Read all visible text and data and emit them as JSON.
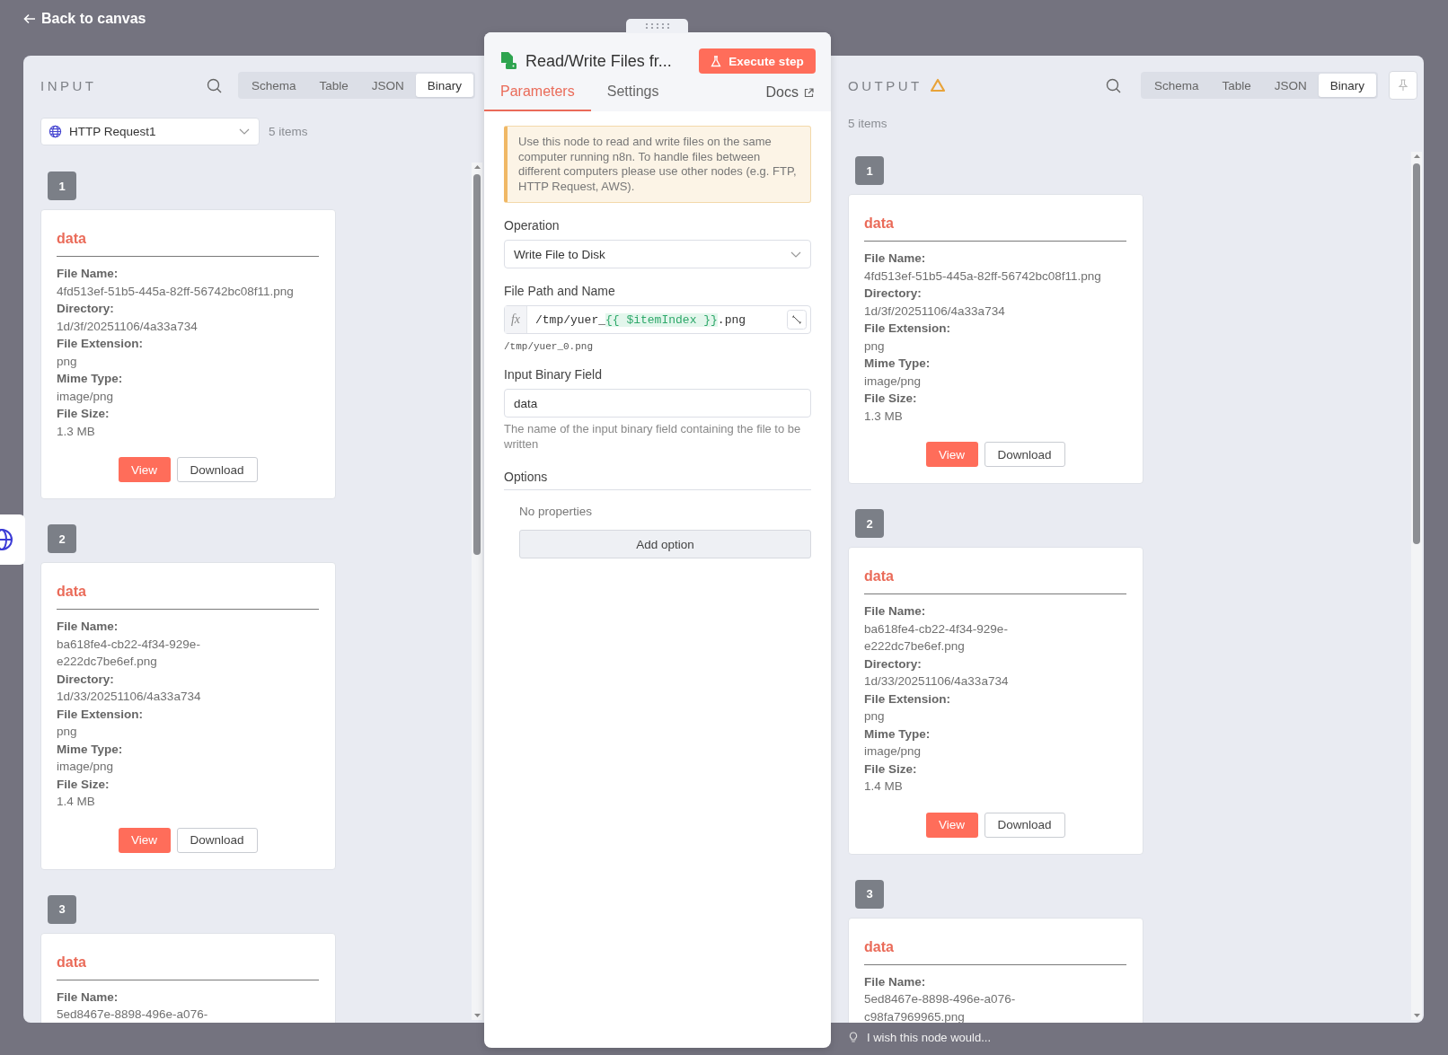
{
  "back_link": "Back to canvas",
  "panels": [
    {
      "kind": "input",
      "title": "INPUT",
      "warning": false,
      "tabs": [
        {
          "label": "Schema",
          "selected": false
        },
        {
          "label": "Table",
          "selected": false
        },
        {
          "label": "JSON",
          "selected": false
        },
        {
          "label": "Binary",
          "selected": true
        }
      ],
      "source": "HTTP Request1",
      "count": "5 items",
      "items": [
        {
          "index": "1",
          "name": "data",
          "fields": [
            {
              "label": "File Name:",
              "lines": [
                "4fd513ef-51b5-445a-82ff-56742bc08f11.png"
              ]
            },
            {
              "label": "Directory:",
              "lines": [
                "1d/3f/20251106/4a33a734"
              ]
            },
            {
              "label": "File Extension:",
              "lines": [
                "png"
              ]
            },
            {
              "label": "Mime Type:",
              "lines": [
                "image/png"
              ]
            },
            {
              "label": "File Size:",
              "lines": [
                "1.3 MB"
              ]
            }
          ],
          "view": "View",
          "download": "Download"
        },
        {
          "index": "2",
          "name": "data",
          "fields": [
            {
              "label": "File Name:",
              "lines": [
                "ba618fe4-cb22-4f34-929e-",
                "e222dc7be6ef.png"
              ]
            },
            {
              "label": "Directory:",
              "lines": [
                "1d/33/20251106/4a33a734"
              ]
            },
            {
              "label": "File Extension:",
              "lines": [
                "png"
              ]
            },
            {
              "label": "Mime Type:",
              "lines": [
                "image/png"
              ]
            },
            {
              "label": "File Size:",
              "lines": [
                "1.4 MB"
              ]
            }
          ],
          "view": "View",
          "download": "Download"
        },
        {
          "index": "3",
          "name": "data",
          "fields": [
            {
              "label": "File Name:",
              "lines": [
                "5ed8467e-8898-496e-a076-"
              ]
            }
          ]
        }
      ]
    },
    {
      "kind": "output",
      "title": "OUTPUT",
      "warning": true,
      "tabs": [
        {
          "label": "Schema",
          "selected": false
        },
        {
          "label": "Table",
          "selected": false
        },
        {
          "label": "JSON",
          "selected": false
        },
        {
          "label": "Binary",
          "selected": true
        }
      ],
      "count": "5 items",
      "items": [
        {
          "index": "1",
          "name": "data",
          "fields": [
            {
              "label": "File Name:",
              "lines": [
                "4fd513ef-51b5-445a-82ff-56742bc08f11.png"
              ]
            },
            {
              "label": "Directory:",
              "lines": [
                "1d/3f/20251106/4a33a734"
              ]
            },
            {
              "label": "File Extension:",
              "lines": [
                "png"
              ]
            },
            {
              "label": "Mime Type:",
              "lines": [
                "image/png"
              ]
            },
            {
              "label": "File Size:",
              "lines": [
                "1.3 MB"
              ]
            }
          ],
          "view": "View",
          "download": "Download"
        },
        {
          "index": "2",
          "name": "data",
          "fields": [
            {
              "label": "File Name:",
              "lines": [
                "ba618fe4-cb22-4f34-929e-",
                "e222dc7be6ef.png"
              ]
            },
            {
              "label": "Directory:",
              "lines": [
                "1d/33/20251106/4a33a734"
              ]
            },
            {
              "label": "File Extension:",
              "lines": [
                "png"
              ]
            },
            {
              "label": "Mime Type:",
              "lines": [
                "image/png"
              ]
            },
            {
              "label": "File Size:",
              "lines": [
                "1.4 MB"
              ]
            }
          ],
          "view": "View",
          "download": "Download"
        },
        {
          "index": "3",
          "name": "data",
          "fields": [
            {
              "label": "File Name:",
              "lines": [
                "5ed8467e-8898-496e-a076-",
                "c98fa7969965.png"
              ]
            }
          ]
        }
      ]
    }
  ],
  "node": {
    "title": "Read/Write Files fr...",
    "execute": "Execute step",
    "tabs": [
      {
        "label": "Parameters",
        "selected": true
      },
      {
        "label": "Settings",
        "selected": false
      }
    ],
    "docs": "Docs",
    "notice": "Use this node to read and write files on the same computer running n8n. To handle files between different computers please use other nodes (e.g. FTP, HTTP Request, AWS).",
    "params": [
      {
        "kind": "select",
        "label": "Operation",
        "value": "Write File to Disk"
      },
      {
        "kind": "expression",
        "label": "File Path and Name",
        "function_label": "fx",
        "parts": [
          {
            "kind": "text",
            "text": "/tmp/yuer_"
          },
          {
            "kind": "expression",
            "text": "{{ $itemIndex }}"
          },
          {
            "kind": "text",
            "text": ".png"
          }
        ],
        "preview": "/tmp/yuer_0.png"
      },
      {
        "kind": "input",
        "label": "Input Binary Field",
        "value": "data",
        "hint": "The name of the input binary field containing the file to be written"
      },
      {
        "kind": "options",
        "label": "Options",
        "empty_text": "No properties",
        "button": "Add option"
      }
    ]
  },
  "feedback": "I wish this node would..."
}
